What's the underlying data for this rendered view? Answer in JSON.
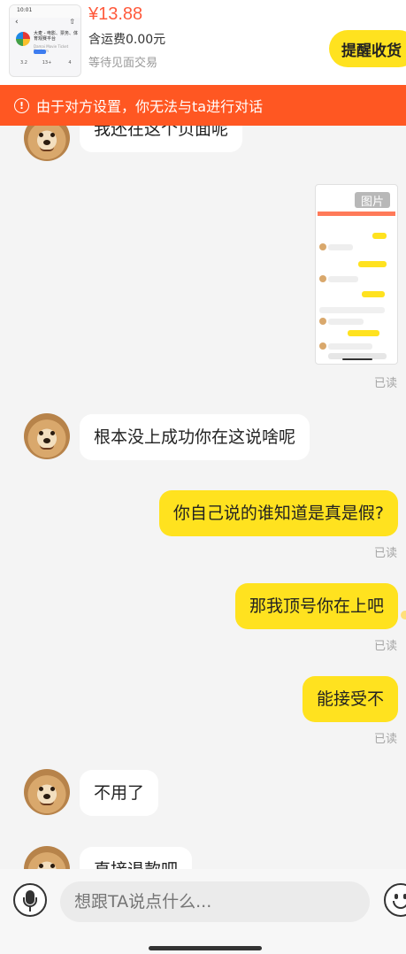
{
  "order": {
    "product_thumb": {
      "time": "10:01",
      "title": "大麦 - 电影、票务、体育观赛平台",
      "subtitle": "Damai Movie Ticket Platform",
      "stats": [
        "3.2",
        "13+",
        "4"
      ]
    },
    "price": "¥13.88",
    "shipping": "含运费0.00元",
    "status": "等待见面交易",
    "remind_button": "提醒收货"
  },
  "warning_banner": {
    "icon": "exclamation-circle-icon",
    "text": "由于对方设置，你无法与ta进行对话"
  },
  "messages": [
    {
      "side": "in",
      "text": "我还在这个页面呢"
    },
    {
      "side": "out",
      "type": "image",
      "label": "图片",
      "read": "已读"
    },
    {
      "side": "in",
      "text": "根本没上成功你在这说啥呢"
    },
    {
      "side": "out",
      "text": "你自己说的谁知道是真是假?",
      "read": "已读"
    },
    {
      "side": "out",
      "text": "那我顶号你在上吧",
      "read": "已读"
    },
    {
      "side": "out",
      "text": "能接受不",
      "read": "已读"
    },
    {
      "side": "in",
      "text": "不用了"
    },
    {
      "side": "in",
      "text": "直接退款吧"
    }
  ],
  "input_bar": {
    "voice_icon": "microphone-icon",
    "placeholder": "想跟TA说点什么...",
    "emoji_icon": "smiley-icon"
  },
  "colors": {
    "accent_yellow": "#ffe21f",
    "warning_orange": "#ff5722",
    "price_red": "#ff5a3c"
  }
}
